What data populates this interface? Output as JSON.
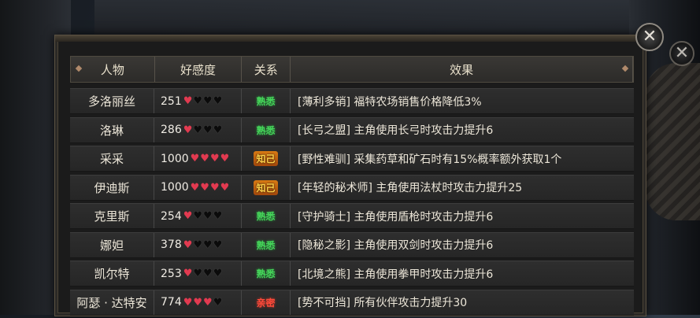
{
  "header": {
    "col_character": "人物",
    "col_affection": "好感度",
    "col_relation": "关系",
    "col_effect": "效果"
  },
  "close": {
    "label": "✕"
  },
  "colors": {
    "heart_full": "#e23a50",
    "heart_empty": "#0b0b0b",
    "relation_green": "#46d45a",
    "relation_gold": "#ffd24a",
    "relation_red": "#ff4a3a"
  },
  "rows": [
    {
      "name": "多洛丽丝",
      "affection": "251",
      "hearts_filled": 1,
      "hearts_total": 4,
      "relation": "熟悉",
      "relation_style": "green",
      "effect": "[薄利多销] 福特农场销售价格降低3%"
    },
    {
      "name": "洛琳",
      "affection": "286",
      "hearts_filled": 1,
      "hearts_total": 4,
      "relation": "熟悉",
      "relation_style": "green",
      "effect": "[长弓之盟] 主角使用长弓时攻击力提升6"
    },
    {
      "name": "采采",
      "affection": "1000",
      "hearts_filled": 4,
      "hearts_total": 4,
      "relation": "知己",
      "relation_style": "gold",
      "effect": "[野性难驯] 采集药草和矿石时有15%概率额外获取1个"
    },
    {
      "name": "伊迪斯",
      "affection": "1000",
      "hearts_filled": 4,
      "hearts_total": 4,
      "relation": "知己",
      "relation_style": "gold",
      "effect": "[年轻的秘术师] 主角使用法杖时攻击力提升25"
    },
    {
      "name": "克里斯",
      "affection": "254",
      "hearts_filled": 1,
      "hearts_total": 4,
      "relation": "熟悉",
      "relation_style": "green",
      "effect": "[守护骑士] 主角使用盾枪时攻击力提升6"
    },
    {
      "name": "娜妲",
      "affection": "378",
      "hearts_filled": 1,
      "hearts_total": 4,
      "relation": "熟悉",
      "relation_style": "green",
      "effect": "[隐秘之影] 主角使用双剑时攻击力提升6"
    },
    {
      "name": "凯尔特",
      "affection": "253",
      "hearts_filled": 1,
      "hearts_total": 4,
      "relation": "熟悉",
      "relation_style": "green",
      "effect": "[北境之熊] 主角使用拳甲时攻击力提升6"
    },
    {
      "name": "阿瑟 · 达特安",
      "affection": "774",
      "hearts_filled": 3,
      "hearts_total": 4,
      "relation": "亲密",
      "relation_style": "red",
      "effect": "[势不可挡] 所有伙伴攻击力提升30"
    }
  ]
}
